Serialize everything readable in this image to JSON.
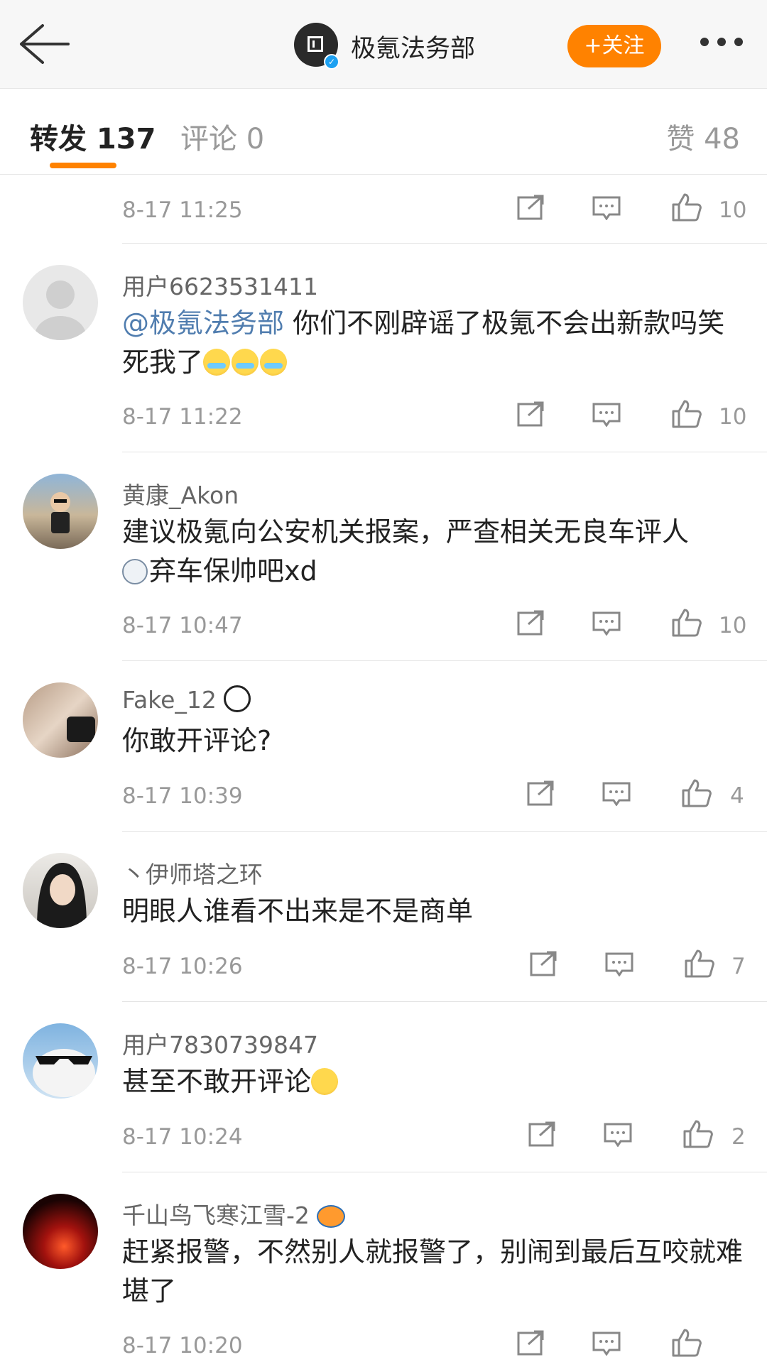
{
  "header": {
    "account_name": "极氪法务部",
    "follow_label": "+关注",
    "back_icon": "back-arrow-icon",
    "more_icon": "more-dots-icon",
    "verified_icon": "verified-badge-icon",
    "accent_color": "#ff8200"
  },
  "tabs": {
    "forward": "转发 137",
    "comment": "评论 0",
    "like": "赞 48"
  },
  "comments": [
    {
      "time": "8-17 11:25",
      "likes": "10"
    },
    {
      "user": "用户6623531411",
      "mention": "@极氪法务部",
      "text": " 你们不刚辟谣了极氪不会出新款吗笑死我了",
      "time": "8-17 11:22",
      "likes": "10"
    },
    {
      "user": "黄康_Akon",
      "text": "建议极氪向公安机关报案，严查相关无良车评人",
      "text2": "弃车保帅吧xd",
      "time": "8-17 10:47",
      "likes": "10"
    },
    {
      "user": "Fake_12",
      "text": "你敢开评论?",
      "time": "8-17 10:39",
      "likes": "4"
    },
    {
      "user": "丶伊师塔之环",
      "text": "明眼人谁看不出来是不是商单",
      "time": "8-17 10:26",
      "likes": "7"
    },
    {
      "user": "用户7830739847",
      "text": "甚至不敢开评论",
      "time": "8-17 10:24",
      "likes": "2"
    },
    {
      "user": "千山鸟飞寒江雪-2",
      "text": "赶紧报警，不然别人就报警了，别闹到最后互咬就难堪了",
      "time": "8-17 10:20",
      "likes": ""
    }
  ]
}
